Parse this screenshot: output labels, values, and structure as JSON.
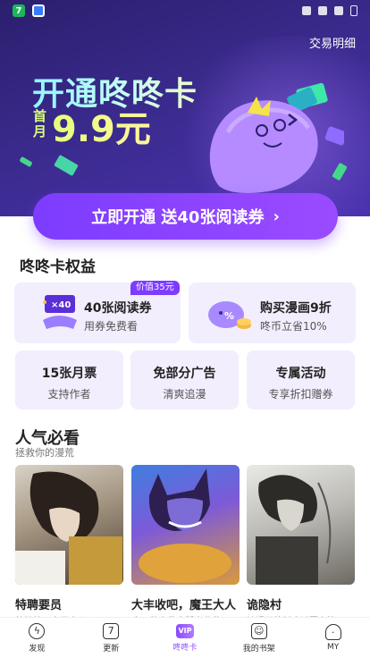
{
  "header": {
    "trade_link": "交易明细"
  },
  "hero": {
    "title": "开通咚咚卡",
    "first_month": "首月",
    "price": "9.9元"
  },
  "cta": {
    "label": "立即开通 送40张阅读券"
  },
  "benefits": {
    "title": "咚咚卡权益",
    "tag": "价值35元",
    "big_cards": [
      {
        "title": "40张阅读券",
        "sub": "用券免费看",
        "badge": "×40"
      },
      {
        "title": "购买漫画9折",
        "sub": "咚币立省10%"
      }
    ],
    "small_cards": [
      {
        "title": "15张月票",
        "sub": "支持作者"
      },
      {
        "title": "免部分广告",
        "sub": "清爽追漫"
      },
      {
        "title": "专属活动",
        "sub": "专享折扣赠券"
      }
    ]
  },
  "popular": {
    "title": "人气必看",
    "subtitle": "拯救你的漫荒",
    "comics": [
      {
        "name": "特聘要员",
        "desc": "特招护卫身份出入"
      },
      {
        "name": "大丰收吧，魔王大人",
        "desc": "魔王种出黄金稻米收获"
      },
      {
        "name": "诡隐村",
        "desc": "被诅咒的村庄谜团上演"
      }
    ]
  },
  "tabs": [
    {
      "label": "发现",
      "icon": "lightning-icon"
    },
    {
      "label": "更新",
      "icon": "calendar-icon",
      "glyph": "7"
    },
    {
      "label": "咚咚卡",
      "icon": "vip-icon",
      "glyph": "VIP",
      "active": true
    },
    {
      "label": "我的书架",
      "icon": "bookshelf-icon"
    },
    {
      "label": "MY",
      "icon": "person-icon"
    }
  ],
  "colors": {
    "accent": "#7d3cff",
    "hero_bg": "#3a2a8c",
    "card_bg": "#f2eefd"
  }
}
